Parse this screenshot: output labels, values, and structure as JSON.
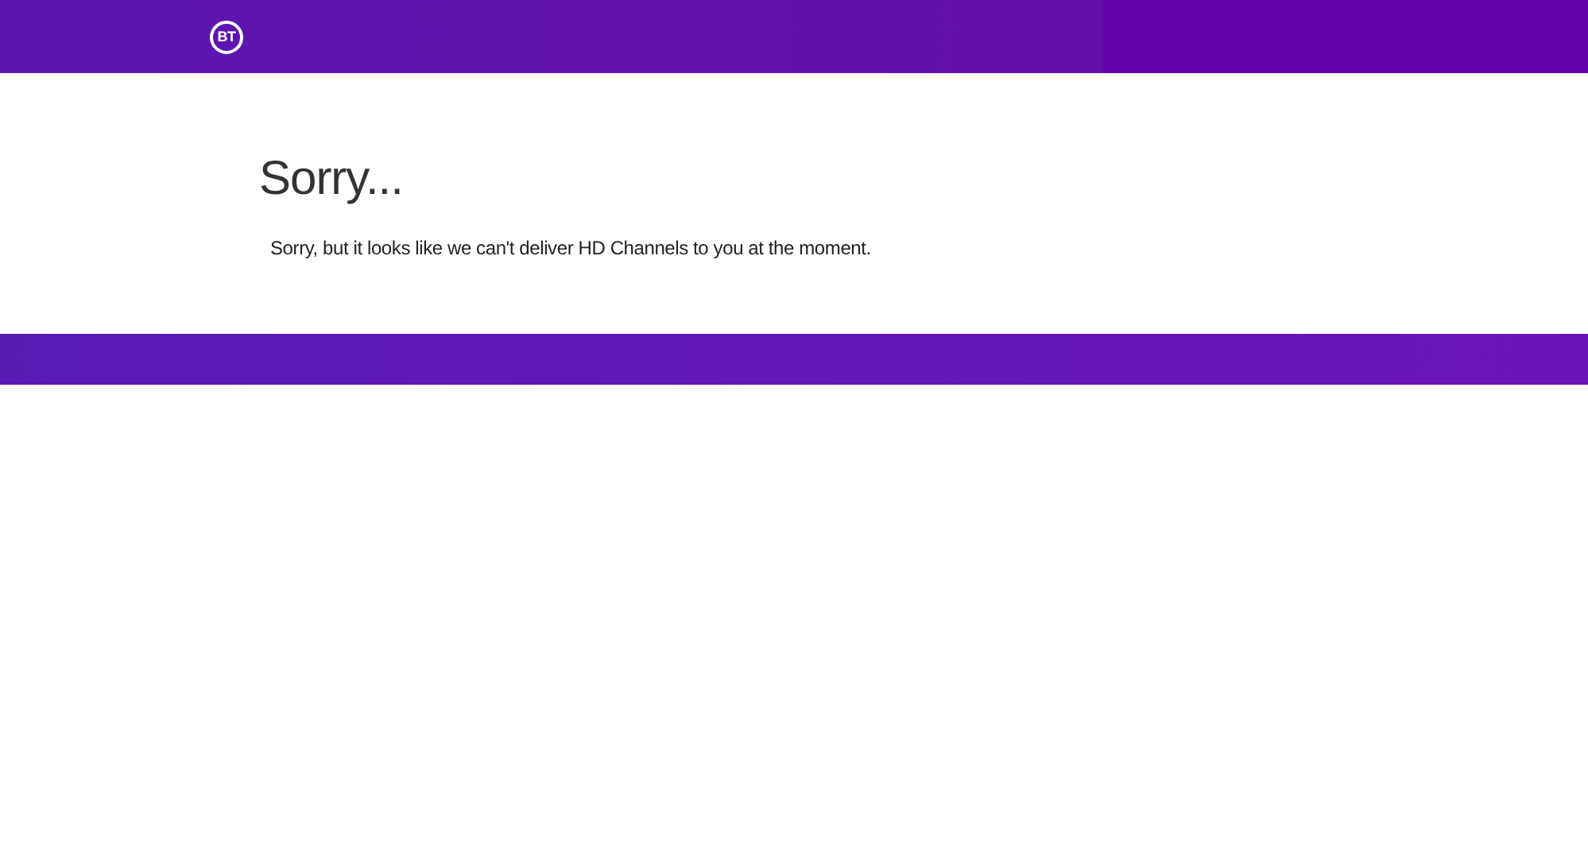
{
  "header": {
    "logo": "BT"
  },
  "message": {
    "title": "Sorry...",
    "text": "Sorry, but it looks like we can't deliver HD Channels to you at the moment."
  }
}
